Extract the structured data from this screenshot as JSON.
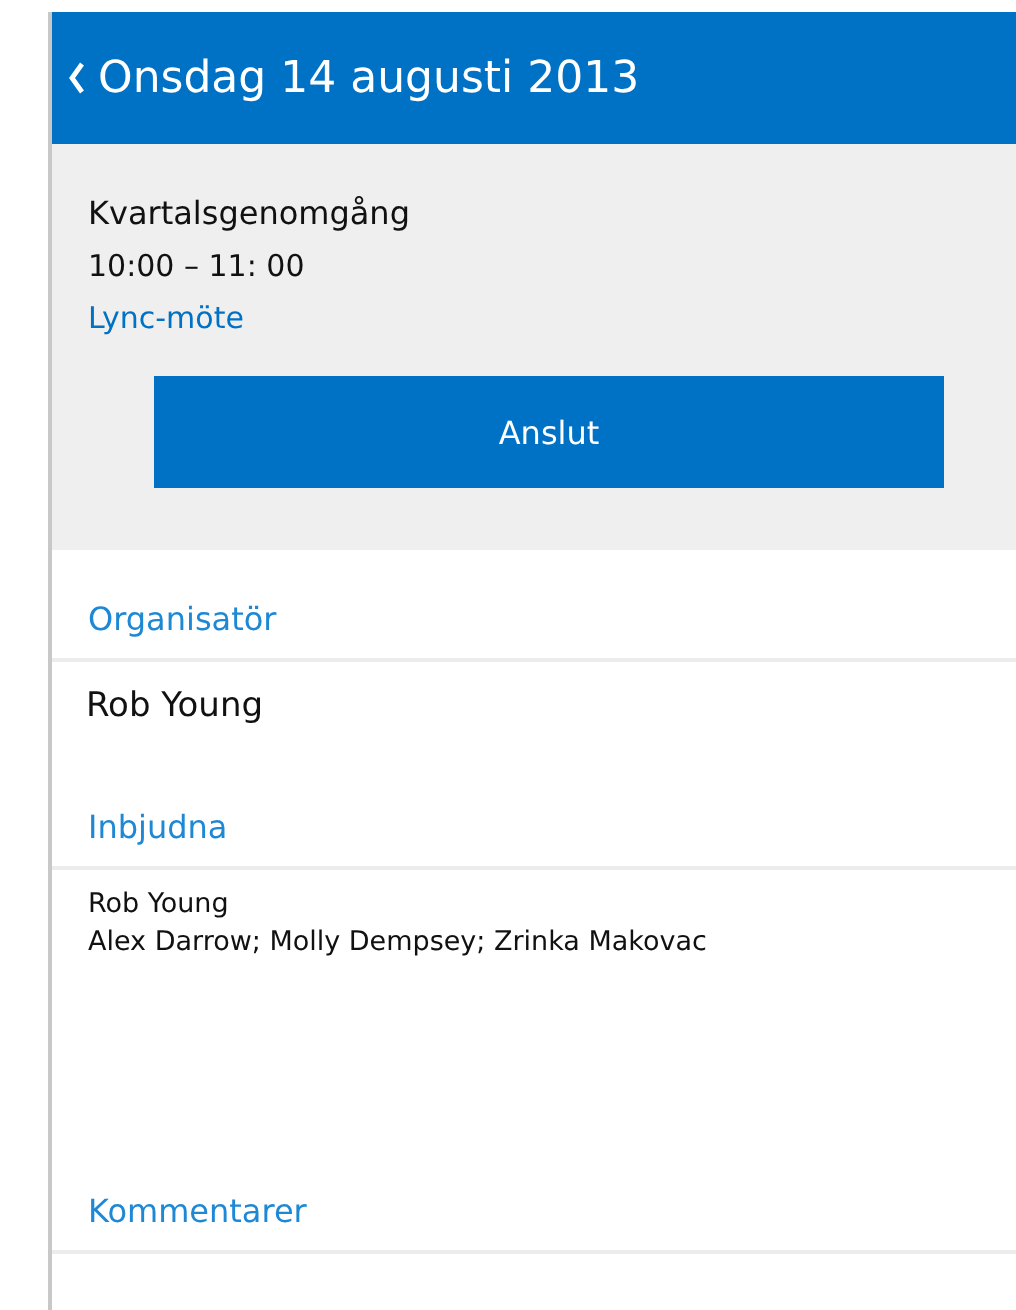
{
  "header": {
    "title": "Onsdag 14 augusti 2013"
  },
  "meeting": {
    "subject": "Kvartalsgenomgång",
    "time": "10:00 – 11: 00",
    "link": "Lync-möte",
    "join_button": "Anslut"
  },
  "organizer": {
    "heading": "Organisatör",
    "name": "Rob Young"
  },
  "invitees": {
    "heading": "Inbjudna",
    "lines": [
      "Rob Young",
      "Alex Darrow; Molly Dempsey; Zrinka Makovac"
    ]
  },
  "comments": {
    "heading": "Kommentarer"
  }
}
